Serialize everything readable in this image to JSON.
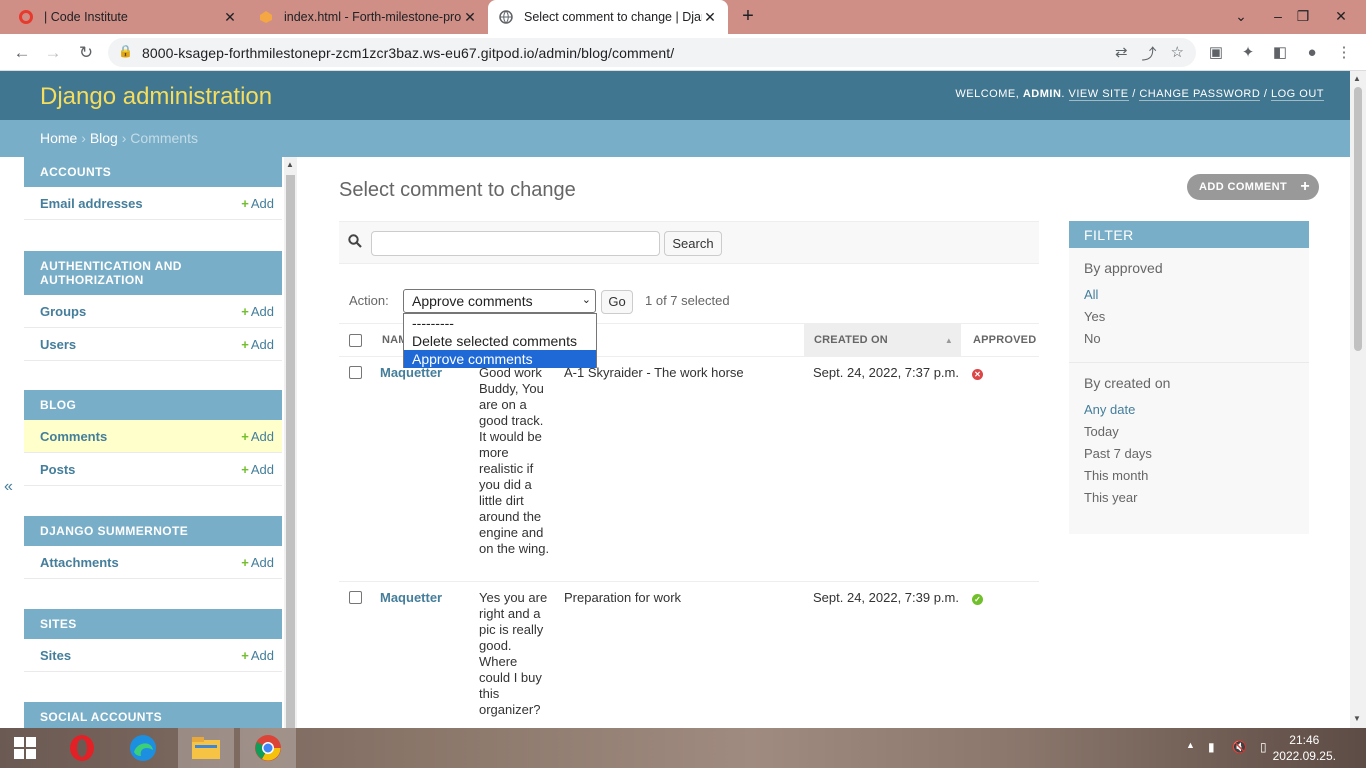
{
  "browser": {
    "tabs": [
      {
        "title": "| Code Institute",
        "icon": "opera-o-icon"
      },
      {
        "title": "index.html - Forth-milestone-pro",
        "icon": "gitpod-icon"
      },
      {
        "title": "Select comment to change | Djan",
        "icon": "globe-icon"
      }
    ],
    "url": "8000-ksagep-forthmilestonepr-zcm1zcr3baz.ws-eu67.gitpod.io/admin/blog/comment/"
  },
  "admin": {
    "branding": "Django administration",
    "welcome": "Welcome,",
    "user": "admin",
    "links": {
      "view_site": "View site",
      "change_password": "Change password",
      "log_out": "Log out"
    },
    "breadcrumb": {
      "home": "Home",
      "blog": "Blog",
      "current": "Comments"
    }
  },
  "sidebar": {
    "add_label": "Add",
    "modules": [
      {
        "caption": "Accounts",
        "items": [
          "Email addresses"
        ]
      },
      {
        "caption": "Authentication and Authorization",
        "items": [
          "Groups",
          "Users"
        ]
      },
      {
        "caption": "Blog",
        "items": [
          "Comments",
          "Posts"
        ]
      },
      {
        "caption": "Django Summernote",
        "items": [
          "Attachments"
        ]
      },
      {
        "caption": "Sites",
        "items": [
          "Sites"
        ]
      },
      {
        "caption": "Social Accounts",
        "items": []
      }
    ]
  },
  "main": {
    "title": "Select comment to change",
    "add_button": "Add comment",
    "search_button": "Search",
    "action_label": "Action:",
    "action_selected": "Approve comments",
    "action_options": [
      "---------",
      "Delete selected comments",
      "Approve comments"
    ],
    "go_button": "Go",
    "selection_count": "1 of 7 selected",
    "columns": [
      "Name",
      "Created on",
      "Approved"
    ],
    "rows": [
      {
        "name": "Maquetter",
        "body": "Good work Buddy, You are on a good track. It would be more realistic if you did a little dirt around the engine and on the wing.",
        "post": "A-1 Skyraider - The work horse",
        "created": "Sept. 24, 2022, 7:37 p.m.",
        "approved": false
      },
      {
        "name": "Maquetter",
        "body": "Yes you are right and a pic is really good. Where could I buy this organizer?",
        "post": "Preparation for work",
        "created": "Sept. 24, 2022, 7:39 p.m.",
        "approved": true
      }
    ]
  },
  "filter": {
    "title": "Filter",
    "approved": {
      "heading": "By approved",
      "options": [
        "All",
        "Yes",
        "No"
      ]
    },
    "created": {
      "heading": "By created on",
      "options": [
        "Any date",
        "Today",
        "Past 7 days",
        "This month",
        "This year"
      ]
    }
  },
  "taskbar": {
    "time": "21:46",
    "date": "2022.09.25."
  }
}
